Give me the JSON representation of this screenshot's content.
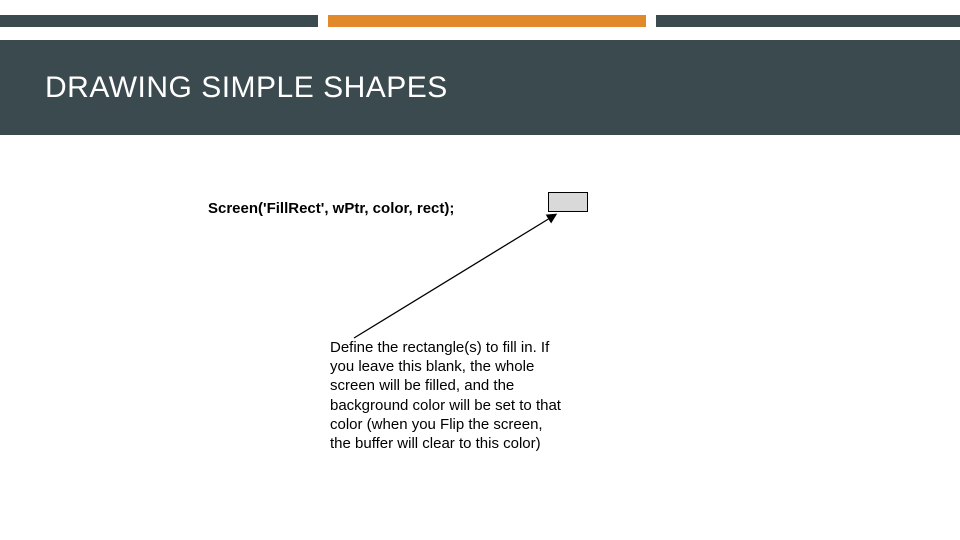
{
  "header": {
    "title": "DRAWING SIMPLE SHAPES"
  },
  "code": {
    "line": "Screen('FillRect', wPtr, color, rect);"
  },
  "description": {
    "text": "Define the rectangle(s) to fill in. If you leave this blank, the whole screen will be filled, and the background color will be set to that color (when you Flip the screen, the buffer will clear to this color)"
  },
  "colors": {
    "accent_dark": "#3b4a4f",
    "accent_orange": "#e28a2b",
    "box_fill": "#d9d9d9"
  }
}
